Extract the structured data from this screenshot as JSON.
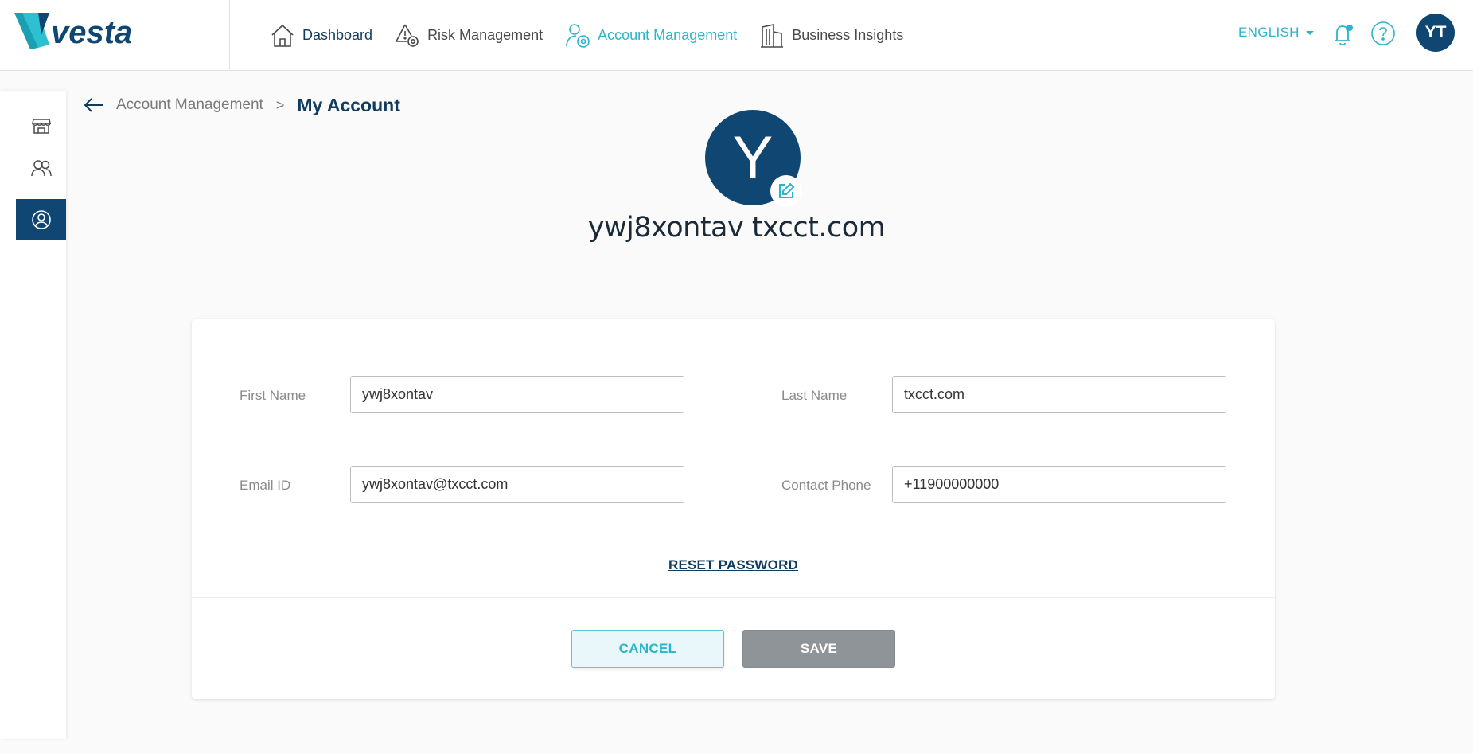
{
  "brand": {
    "logo_text": "vesta",
    "accent_color": "#2cb4c8",
    "primary_color": "#0f4672"
  },
  "nav": {
    "items": [
      {
        "label": "Dashboard",
        "icon": "home-icon"
      },
      {
        "label": "Risk Management",
        "icon": "risk-warning-gear-icon"
      },
      {
        "label": "Account Management",
        "icon": "user-gear-icon",
        "active": true
      },
      {
        "label": "Business Insights",
        "icon": "building-icon"
      }
    ]
  },
  "header": {
    "language": "ENGLISH",
    "user_initials": "YT"
  },
  "sidebar": {
    "items": [
      {
        "icon": "store-icon"
      },
      {
        "icon": "users-icon"
      },
      {
        "icon": "user-circle-icon",
        "active": true
      }
    ]
  },
  "breadcrumb": {
    "parent": "Account Management",
    "separator": ">",
    "current": "My Account"
  },
  "profile": {
    "avatar_initial": "Y",
    "display_name": "ywj8xontav txcct.com"
  },
  "form": {
    "first_name_label": "First Name",
    "first_name_value": "ywj8xontav",
    "last_name_label": "Last Name",
    "last_name_value": "txcct.com",
    "email_label": "Email ID",
    "email_value": "ywj8xontav@txcct.com",
    "phone_label": "Contact Phone",
    "phone_value": "+11900000000",
    "reset_password": "RESET PASSWORD",
    "cancel_label": "CANCEL",
    "save_label": "SAVE"
  }
}
